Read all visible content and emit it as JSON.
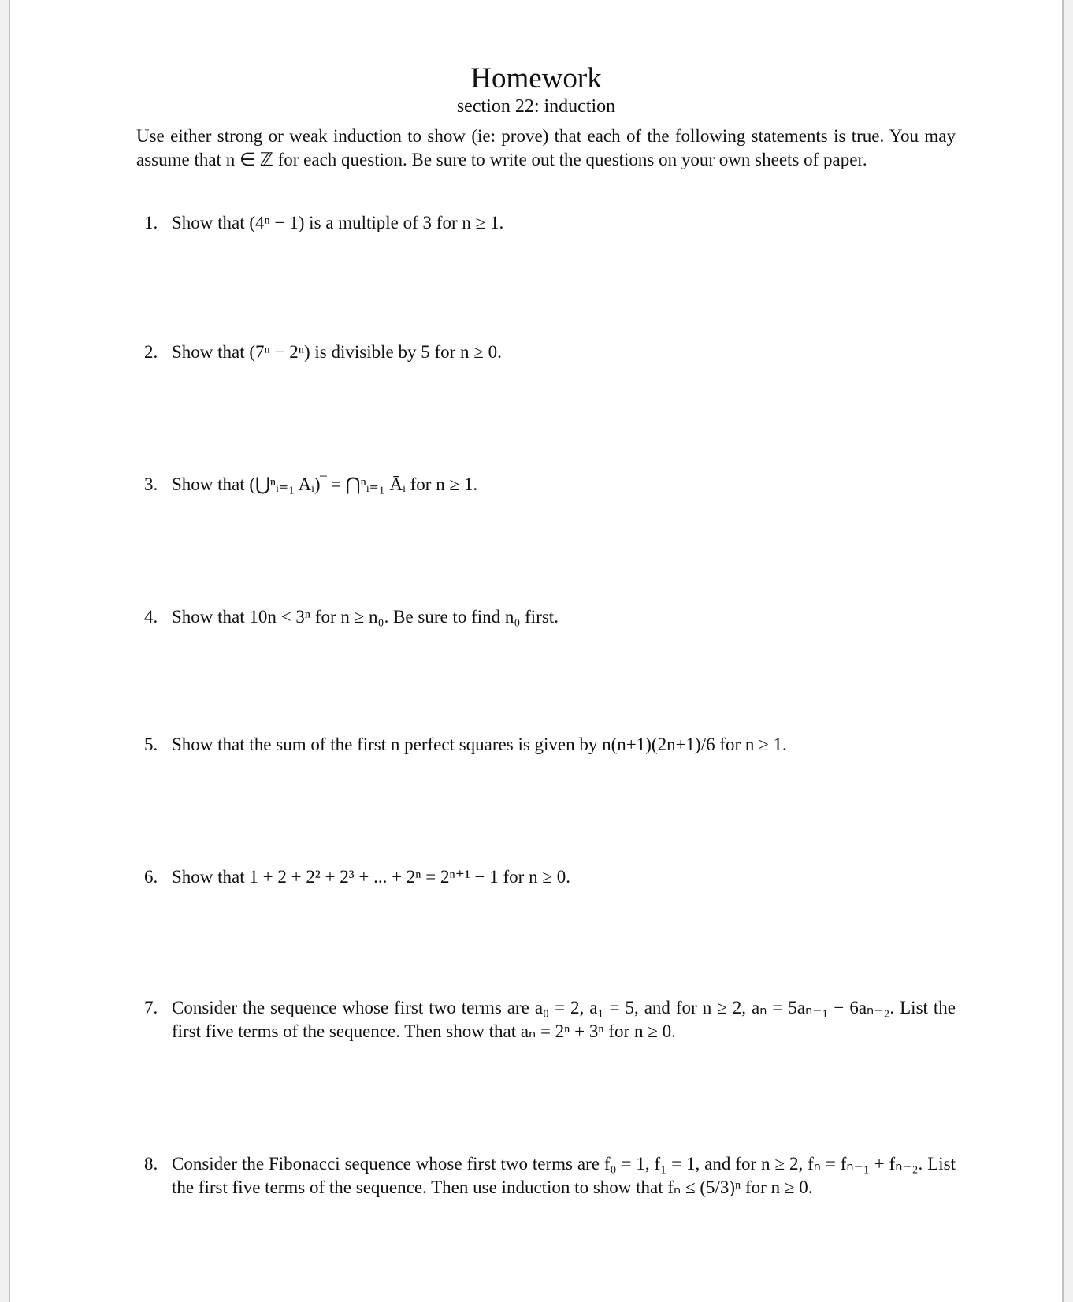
{
  "document": {
    "title": "Homework",
    "subtitle": "section 22: induction",
    "intro": "Use either strong or weak induction to show (ie: prove) that each of the following statements is true. You may assume that n ∈ ℤ for each question. Be sure to write out the questions on your own sheets of paper.",
    "questions": [
      {
        "number": "1.",
        "text": "Show that (4ⁿ − 1) is a multiple of 3 for n ≥ 1."
      },
      {
        "number": "2.",
        "text": "Show that (7ⁿ − 2ⁿ) is divisible by 5 for n ≥ 0."
      },
      {
        "number": "3.",
        "text": "Show that (⋃ⁿᵢ₌₁ Aᵢ)‾ = ⋂ⁿᵢ₌₁ Āᵢ for n ≥ 1."
      },
      {
        "number": "4.",
        "text": "Show that 10n < 3ⁿ for n ≥ n₀. Be sure to find n₀ first."
      },
      {
        "number": "5.",
        "text": "Show that the sum of the first n perfect squares is given by n(n+1)(2n+1)/6 for n ≥ 1."
      },
      {
        "number": "6.",
        "text": "Show that 1 + 2 + 2² + 2³ + ... + 2ⁿ = 2ⁿ⁺¹ − 1 for n ≥ 0."
      },
      {
        "number": "7.",
        "text": "Consider the sequence whose first two terms are a₀ = 2, a₁ = 5, and for n ≥ 2, aₙ = 5aₙ₋₁ − 6aₙ₋₂. List the first five terms of the sequence. Then show that aₙ = 2ⁿ + 3ⁿ for n ≥ 0."
      },
      {
        "number": "8.",
        "text": "Consider the Fibonacci sequence whose first two terms are f₀ = 1, f₁ = 1, and for n ≥ 2, fₙ = fₙ₋₁ + fₙ₋₂. List the first five terms of the sequence. Then use induction to show that fₙ ≤ (5/3)ⁿ for n ≥ 0."
      }
    ]
  }
}
